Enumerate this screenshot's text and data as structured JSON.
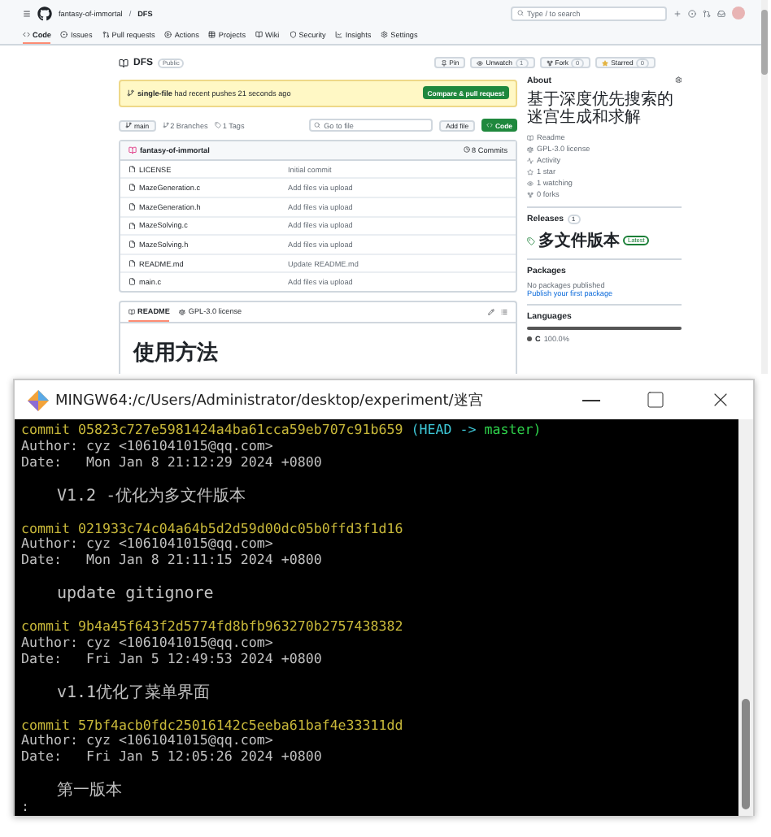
{
  "github": {
    "owner": "fantasy-of-immortal",
    "separator": "/",
    "repo": "DFS",
    "search_placeholder": "Type / to search",
    "nav_tabs": [
      {
        "label": "Code",
        "selected": true
      },
      {
        "label": "Issues",
        "selected": false
      },
      {
        "label": "Pull requests",
        "selected": false
      },
      {
        "label": "Actions",
        "selected": false
      },
      {
        "label": "Projects",
        "selected": false
      },
      {
        "label": "Wiki",
        "selected": false
      },
      {
        "label": "Security",
        "selected": false
      },
      {
        "label": "Insights",
        "selected": false
      },
      {
        "label": "Settings",
        "selected": false
      }
    ],
    "repo_name": "DFS",
    "visibility": "Public",
    "repo_actions": [
      {
        "kind": "pin",
        "label": "Pin"
      },
      {
        "kind": "watch",
        "label": "Unwatch",
        "count": "1"
      },
      {
        "kind": "fork",
        "label": "Fork",
        "count": "0"
      },
      {
        "kind": "star",
        "label": "Starred",
        "count": "0"
      }
    ],
    "banner": {
      "branch": "single-file",
      "text": "had recent pushes 21 seconds ago",
      "button": "Compare & pull request"
    },
    "toolbar": {
      "branch": "main",
      "branches": "2 Branches",
      "tags": "1 Tags",
      "search_placeholder": "Go to file",
      "add_file": "Add file",
      "code": "Code"
    },
    "latest_commit": {
      "author": "fantasy-of-immortal",
      "commits": "8 Commits"
    },
    "files": [
      {
        "name": "LICENSE",
        "message": "Initial commit"
      },
      {
        "name": "MazeGeneration.c",
        "message": "Add files via upload"
      },
      {
        "name": "MazeGeneration.h",
        "message": "Add files via upload"
      },
      {
        "name": "MazeSolving.c",
        "message": "Add files via upload"
      },
      {
        "name": "MazeSolving.h",
        "message": "Add files via upload"
      },
      {
        "name": "README.md",
        "message": "Update README.md"
      },
      {
        "name": "main.c",
        "message": "Add files via upload"
      }
    ],
    "readme_tabs": [
      {
        "kind": "readme",
        "label": "README",
        "selected": true
      },
      {
        "kind": "license",
        "label": "GPL-3.0 license",
        "selected": false
      }
    ],
    "readme_heading": "使用方法",
    "about": {
      "title": "About",
      "description": "基于深度优先搜索的迷宫生成和求解",
      "links": [
        {
          "kind": "readme",
          "label": "Readme"
        },
        {
          "kind": "license",
          "label": "GPL-3.0 license"
        },
        {
          "kind": "activity",
          "label": "Activity"
        },
        {
          "kind": "star",
          "label": "1 star"
        },
        {
          "kind": "watch",
          "label": "1 watching"
        },
        {
          "kind": "fork",
          "label": "0 forks"
        }
      ]
    },
    "releases": {
      "title": "Releases",
      "count": "1",
      "name": "多文件版本",
      "badge": "Latest"
    },
    "packages": {
      "title": "Packages",
      "text": "No packages published",
      "link": "Publish your first package"
    },
    "languages": {
      "title": "Languages",
      "items": [
        {
          "name": "C",
          "share": "100.0%",
          "level": 1,
          "color": "#555555"
        }
      ]
    }
  },
  "terminal": {
    "title": "MINGW64:/c/Users/Administrator/desktop/experiment/迷宫",
    "commits": [
      {
        "commit": "commit 05823c727e5981424a4ba61cca59eb707c91b659",
        "ref_head": "(HEAD ->",
        "ref_branch": "master)",
        "author": "Author: cyz <1061041015@qq.com>",
        "date": "Date:   Mon Jan 8 21:12:29 2024 +0800",
        "message": "V1.2 -优化为多文件版本"
      },
      {
        "commit": "commit 021933c74c04a64b5d2d59d00dc05b0ffd3f1d16",
        "author": "Author: cyz <1061041015@qq.com>",
        "date": "Date:   Mon Jan 8 21:11:15 2024 +0800",
        "message": "update gitignore"
      },
      {
        "commit": "commit 9b4a45f643f2d5774fd8bfb963270b2757438382",
        "author": "Author: cyz <1061041015@qq.com>",
        "date": "Date:   Fri Jan 5 12:49:53 2024 +0800",
        "message": "v1.1优化了菜单界面"
      },
      {
        "commit": "commit 57bf4acb0fdc25016142c5eeba61baf4e33311dd",
        "author": "Author: cyz <1061041015@qq.com>",
        "date": "Date:   Fri Jan 5 12:05:26 2024 +0800",
        "message": "第一版本"
      }
    ],
    "prompt": ":"
  }
}
